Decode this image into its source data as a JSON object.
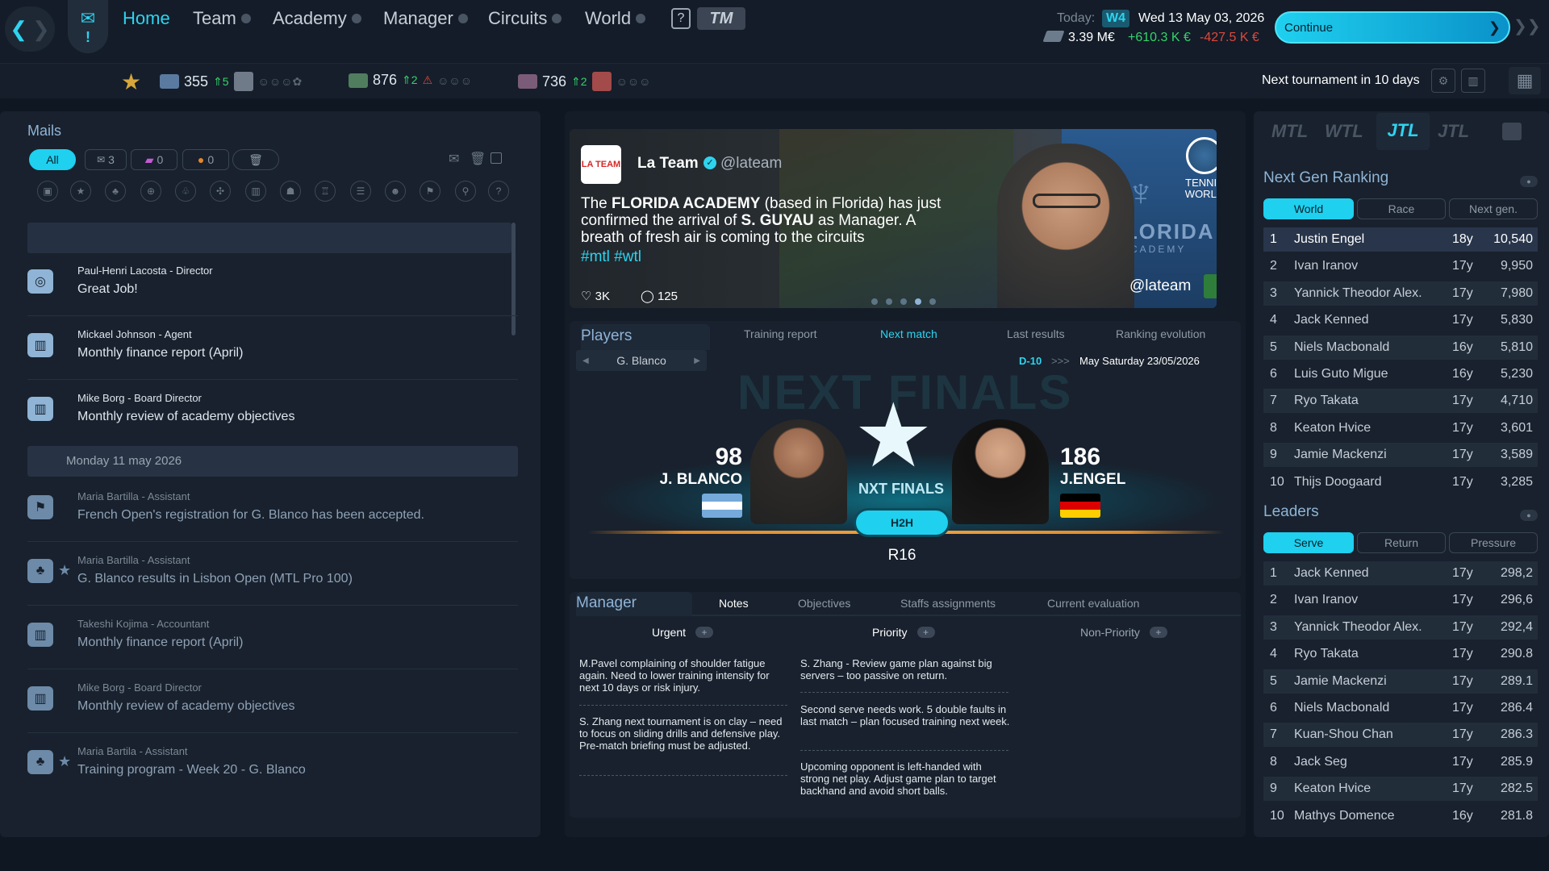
{
  "nav": {
    "items": [
      "Home",
      "Team",
      "Academy",
      "Manager",
      "Circuits",
      "World"
    ],
    "help": "?",
    "logo": "TM"
  },
  "date": {
    "today_label": "Today:",
    "week": "W4",
    "date": "Wed 13 May 03, 2026",
    "money": "3.39 M€",
    "income": "+610.3 K €",
    "expense": "-427.5 K €"
  },
  "continue": {
    "label": "Continue"
  },
  "stats": [
    {
      "value": "355",
      "delta": "5"
    },
    {
      "value": "876",
      "delta": "2"
    },
    {
      "value": "736",
      "delta": "2"
    }
  ],
  "next_tournament": "Next tournament in 10 days",
  "mails": {
    "title": "Mails",
    "filters": [
      {
        "label": "All"
      },
      {
        "label": "3"
      },
      {
        "label": "0"
      },
      {
        "label": "0"
      }
    ],
    "items": [
      {
        "from": "Paul-Henri Lacosta - Director",
        "subject": "Great Job!",
        "icon": "target-icon",
        "read": false
      },
      {
        "from": "Mickael Johnson - Agent",
        "subject": "Monthly finance report (April)",
        "icon": "bank-icon",
        "read": false
      },
      {
        "from": "Mike Borg - Board Director",
        "subject": "Monthly review of academy objectives",
        "icon": "bank-icon",
        "read": false
      }
    ],
    "date_separator": "Monday 11 may 2026",
    "older": [
      {
        "from": "Maria Bartilla - Assistant",
        "subject": "French Open's registration for G. Blanco has been accepted.",
        "icon": "flag-icon",
        "starred": false
      },
      {
        "from": "Maria Bartilla - Assistant",
        "subject": "G. Blanco results in Lisbon Open (MTL Pro 100)",
        "icon": "group-icon",
        "starred": true
      },
      {
        "from": "Takeshi Kojima - Accountant",
        "subject": "Monthly finance report (April)",
        "icon": "bank-icon",
        "starred": false
      },
      {
        "from": "Mike Borg - Board Director",
        "subject": "Monthly review of academy objectives",
        "icon": "bank-icon",
        "starred": false
      },
      {
        "from": "Maria Bartila - Assistant",
        "subject": "Training program - Week 20 - G. Blanco",
        "icon": "group-icon",
        "starred": true
      }
    ]
  },
  "news": {
    "logo": "LA TEAM",
    "author": "La Team",
    "handle": "@lateam",
    "text_parts": [
      "The ",
      "FLORIDA ACADEMY",
      " (based in Florida) has just confirmed the arrival of ",
      "S. GUYAU",
      " as Manager. A breath of fresh air is coming to the circuits"
    ],
    "hashtags": "#mtl #wtl",
    "likes": "3K",
    "comments": "125",
    "brand": "TENNIS WORLD",
    "overlay_handle": "@lateam",
    "banner_text": "FLORIDA",
    "banner_sub": "ACADEMY"
  },
  "players": {
    "title": "Players",
    "tabs": [
      "Training report",
      "Next match",
      "Last results",
      "Ranking evolution"
    ],
    "selected": "G. Blanco",
    "countdown": "D-10",
    "arrows": ">>>",
    "match_date": "May Saturday 23/05/2026",
    "bg_text": "NEXT FINALS",
    "event": "NXT FINALS",
    "h2h": "H2H",
    "round": "R16",
    "p1": {
      "rank": "98",
      "name": "J. BLANCO"
    },
    "p2": {
      "rank": "186",
      "name": "J.ENGEL"
    }
  },
  "manager": {
    "title": "Manager",
    "tabs": [
      "Notes",
      "Objectives",
      "Staffs assignments",
      "Current evaluation"
    ],
    "columns": [
      "Urgent",
      "Priority",
      "Non-Priority"
    ],
    "urgent": [
      "M.Pavel complaining of shoulder fatigue again. Need to lower training intensity for next 10 days or risk injury.",
      "S. Zhang next tournament is on clay – need to focus on sliding drills and defensive play. Pre-match briefing must be adjusted."
    ],
    "priority": [
      "S. Zhang - Review game plan against big servers – too passive on return.",
      "Second serve needs work. 5 double faults in last match – plan focused training next week.",
      "Upcoming opponent is left-handed with strong net play. Adjust game plan to target backhand and avoid short balls."
    ]
  },
  "tours": [
    "MTL",
    "WTL",
    "JTL",
    "JTL"
  ],
  "ranking": {
    "title": "Next Gen Ranking",
    "tabs": [
      "World",
      "Race",
      "Next gen."
    ],
    "rows": [
      {
        "pos": "1",
        "name": "Justin Engel",
        "age": "18y",
        "pts": "10,540"
      },
      {
        "pos": "2",
        "name": "Ivan Iranov",
        "age": "17y",
        "pts": "9,950"
      },
      {
        "pos": "3",
        "name": "Yannick Theodor Alex.",
        "age": "17y",
        "pts": "7,980"
      },
      {
        "pos": "4",
        "name": "Jack Kenned",
        "age": "17y",
        "pts": "5,830"
      },
      {
        "pos": "5",
        "name": "Niels Macbonald",
        "age": "16y",
        "pts": "5,810"
      },
      {
        "pos": "6",
        "name": "Luis Guto Migue",
        "age": "16y",
        "pts": "5,230"
      },
      {
        "pos": "7",
        "name": "Ryo Takata",
        "age": "17y",
        "pts": "4,710"
      },
      {
        "pos": "8",
        "name": "Keaton Hvice",
        "age": "17y",
        "pts": "3,601"
      },
      {
        "pos": "9",
        "name": "Jamie Mackenzi",
        "age": "17y",
        "pts": "3,589"
      },
      {
        "pos": "10",
        "name": "Thijs Doogaard",
        "age": "17y",
        "pts": "3,285"
      }
    ]
  },
  "leaders": {
    "title": "Leaders",
    "tabs": [
      "Serve",
      "Return",
      "Pressure"
    ],
    "rows": [
      {
        "pos": "1",
        "name": "Jack Kenned",
        "age": "17y",
        "pts": "298,2"
      },
      {
        "pos": "2",
        "name": "Ivan Iranov",
        "age": "17y",
        "pts": "296,6"
      },
      {
        "pos": "3",
        "name": "Yannick Theodor Alex.",
        "age": "17y",
        "pts": "292,4"
      },
      {
        "pos": "4",
        "name": "Ryo Takata",
        "age": "17y",
        "pts": "290.8"
      },
      {
        "pos": "5",
        "name": "Jamie Mackenzi",
        "age": "17y",
        "pts": "289.1"
      },
      {
        "pos": "6",
        "name": "Niels Macbonald",
        "age": "17y",
        "pts": "286.4"
      },
      {
        "pos": "7",
        "name": "Kuan-Shou Chan",
        "age": "17y",
        "pts": "286.3"
      },
      {
        "pos": "8",
        "name": "Jack Seg",
        "age": "17y",
        "pts": "285.9"
      },
      {
        "pos": "9",
        "name": "Keaton Hvice",
        "age": "17y",
        "pts": "282.5"
      },
      {
        "pos": "10",
        "name": "Mathys Domence",
        "age": "16y",
        "pts": "281.8"
      }
    ]
  }
}
